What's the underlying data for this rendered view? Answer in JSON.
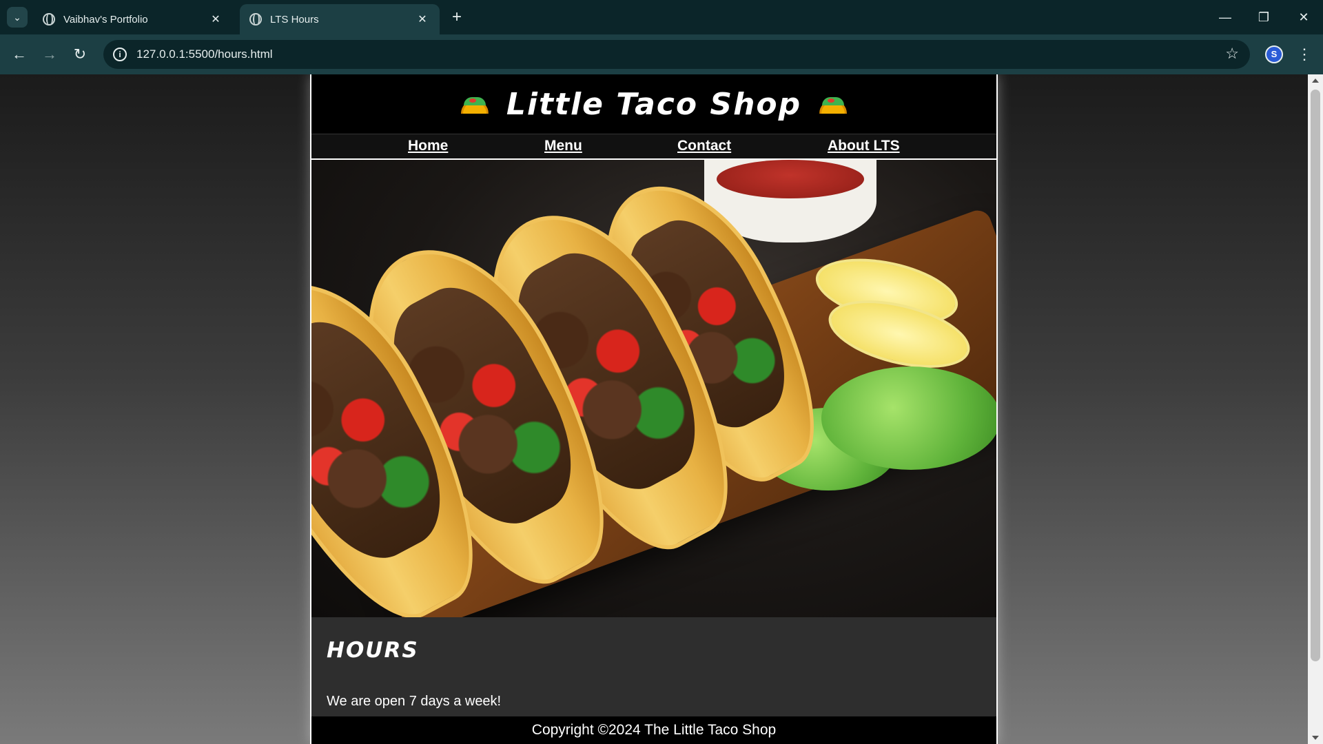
{
  "browser": {
    "tabs": [
      {
        "title": "Vaibhav's Portfolio",
        "active": false
      },
      {
        "title": "LTS Hours",
        "active": true
      }
    ],
    "url": "127.0.0.1:5500/hours.html"
  },
  "icons": {
    "tab_search": "chevron-down-icon",
    "globe": "globe-icon",
    "close": "close-icon",
    "new_tab": "plus-icon",
    "back": "arrow-left-icon",
    "forward": "arrow-right-icon",
    "reload": "reload-icon",
    "site_info": "info-icon",
    "bookmark": "star-icon",
    "extension": "extension-icon",
    "menu": "kebab-menu-icon",
    "taco": "taco-icon"
  },
  "site": {
    "title": "Little Taco Shop",
    "nav": [
      {
        "label": "Home"
      },
      {
        "label": "Menu"
      },
      {
        "label": "Contact"
      },
      {
        "label": "About LTS"
      }
    ],
    "hours": {
      "heading": "HOURS",
      "text": "We are open 7 days a week!"
    },
    "footer": "Copyright ©2024 The Little Taco Shop"
  },
  "colors": {
    "header_bg": "#000000",
    "page_bg": "#2e2e2e",
    "browser_frame": "#0b2529",
    "toolbar": "#1c3f44",
    "text": "#ffffff"
  }
}
